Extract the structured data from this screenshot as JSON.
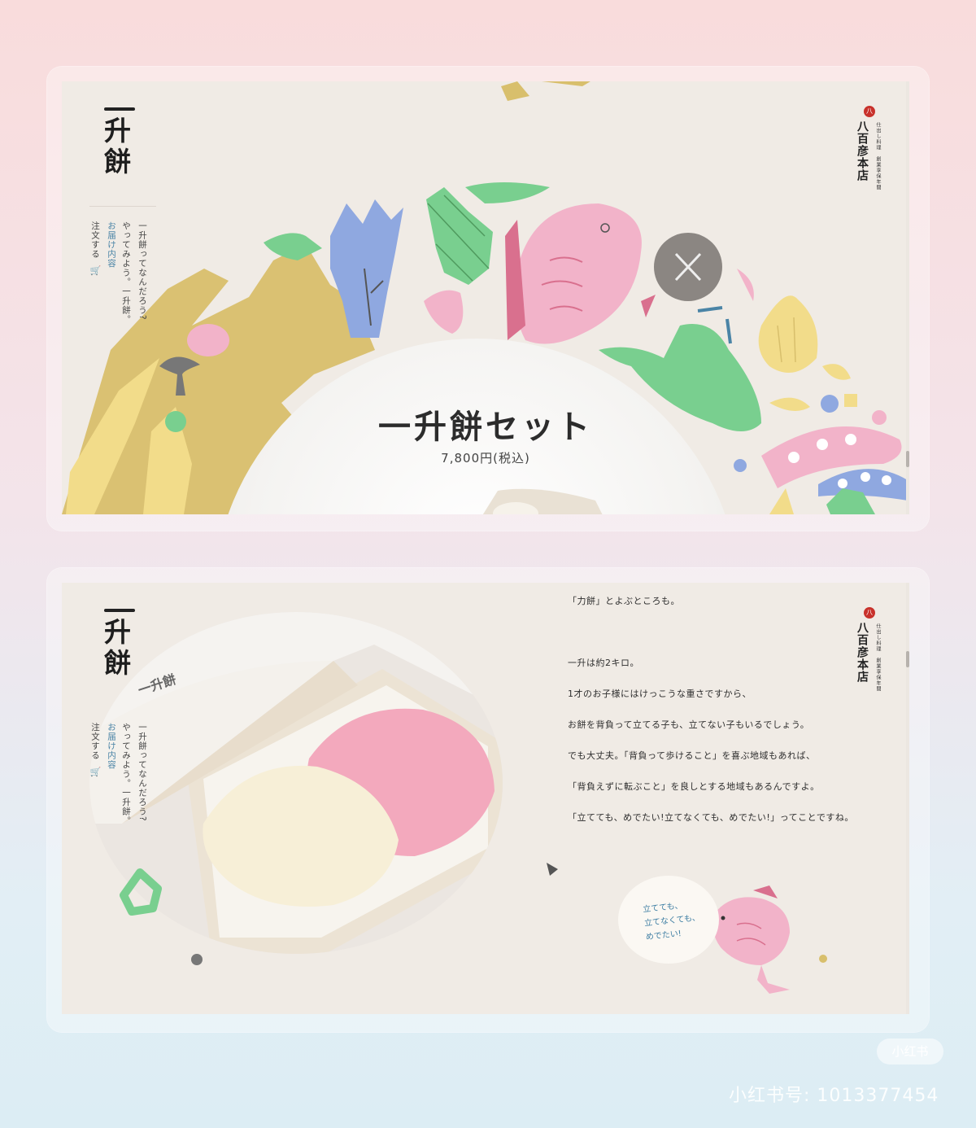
{
  "logo": {
    "chars": [
      "升",
      "餅"
    ]
  },
  "nav": {
    "about": "一升餅ってなんだろう?",
    "try": "やってみよう。一升餅。",
    "contents": "お届け内容",
    "order": "注文する",
    "cart_icon": "cart-icon"
  },
  "brand": {
    "seal": "八",
    "name": "八百彦本店",
    "sub": "仕出し料理　創業享保年間"
  },
  "hero": {
    "title": "一升餅セット",
    "price": "7,800円(税込)"
  },
  "story": {
    "lines": [
      "「力餅」とよぶところも。",
      "一升は約2キロ。",
      "1才のお子様にはけっこうな重さですから、",
      "お餅を背負って立てる子も、立てない子もいるでしょう。",
      "でも大丈夫。「背負って歩けること」を喜ぶ地域もあれば、",
      "「背負えずに転ぶこと」を良しとする地域もあるんですよ。",
      "「立てても、めでたい!立てなくても、めでたい!」ってことですね。"
    ],
    "bubble": [
      "立てても、",
      "立てなくても、",
      "めでたい!"
    ],
    "box_label": "一升餅"
  },
  "watermark": {
    "app": "小红书",
    "id": "小红书号: 1013377454"
  },
  "colors": {
    "page_bg": "#f0ebe5",
    "pink": "#f2b3c9",
    "green": "#79cf8f",
    "blue": "#8fa8e0",
    "yellow": "#f2dc8a",
    "gold": "#d8bf6c",
    "accent_blue": "#4a84a6",
    "seal_red": "#c8312b"
  }
}
